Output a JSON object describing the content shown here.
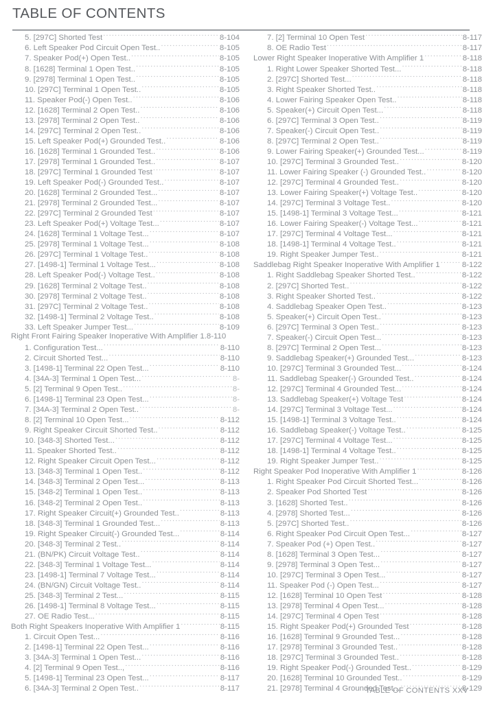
{
  "document": {
    "title": "TABLE OF CONTENTS",
    "footer": "TABLE OF CONTENTS XXV"
  },
  "columns": [
    {
      "name": "left-column",
      "entries": [
        {
          "level": "item",
          "label": "5. [297C] Shorted Test",
          "page": "8-104"
        },
        {
          "level": "item",
          "label": "6. Left Speaker Pod Circuit Open Test..",
          "page": "8-105"
        },
        {
          "level": "item",
          "label": "7. Speaker Pod(+) Open Test..",
          "page": "8-105"
        },
        {
          "level": "item",
          "label": "8. [1628] Terminal 1 Open Test..",
          "page": "8-105"
        },
        {
          "level": "item",
          "label": "9. [2978] Terminal 1 Open Test..",
          "page": "8-105"
        },
        {
          "level": "item",
          "label": "10. [297C] Terminal 1 Open Test..",
          "page": "8-105"
        },
        {
          "level": "item",
          "label": "11. Speaker Pod(-) Open Test..",
          "page": "8-106"
        },
        {
          "level": "item",
          "label": "12. [1628] Terminal 2 Open Test..",
          "page": "8-106"
        },
        {
          "level": "item",
          "label": "13. [2978] Terminal 2 Open Test..",
          "page": "8-106"
        },
        {
          "level": "item",
          "label": "14. [297C] Terminal 2 Open Test..",
          "page": "8-106"
        },
        {
          "level": "item",
          "label": "15. Left Speaker Pod(+) Grounded Test..",
          "page": "8-106"
        },
        {
          "level": "item",
          "label": "16. [1628] Terminal 1 Grounded Test..",
          "page": "8-106"
        },
        {
          "level": "item",
          "label": "17. [2978] Terminal 1 Grounded Test..",
          "page": "8-107"
        },
        {
          "level": "item",
          "label": "18. [297C] Terminal 1 Grounded Test",
          "page": "8-107"
        },
        {
          "level": "item",
          "label": "19. Left Speaker Pod(-) Grounded Test..",
          "page": "8-107"
        },
        {
          "level": "item",
          "label": "20. [1628] Terminal 2 Grounded Test...",
          "page": "8-107"
        },
        {
          "level": "item",
          "label": "21. [2978] Terminal 2 Grounded Test...",
          "page": "8-107"
        },
        {
          "level": "item",
          "label": "22. [297C] Terminal 2 Grounded Test",
          "page": "8-107"
        },
        {
          "level": "item",
          "label": "23. Left Speaker Pod(+) Voltage Test...",
          "page": "8-107"
        },
        {
          "level": "item",
          "label": "24. [1628] Terminal 1 Voltage Test...",
          "page": "8-107"
        },
        {
          "level": "item",
          "label": "25. [2978] Terminal 1 Voltage Test...",
          "page": "8-108"
        },
        {
          "level": "item",
          "label": "26. [297C] Terminal 1 Voltage Test..",
          "page": "8-108"
        },
        {
          "level": "item",
          "label": "27. [1498-1] Terminal 1 Voltage Test...",
          "page": "8-108"
        },
        {
          "level": "item",
          "label": "28. Left Speaker Pod(-) Voltage Test..",
          "page": "8-108"
        },
        {
          "level": "item",
          "label": "29. [1628] Terminal 2 Voltage Test..",
          "page": "8-108"
        },
        {
          "level": "item",
          "label": "30. [2978] Terminal 2 Voltage Test..",
          "page": "8-108"
        },
        {
          "level": "item",
          "label": "31. [297C] Terminal 2 Voltage Test..",
          "page": "8-108"
        },
        {
          "level": "item",
          "label": "32. [1498-1] Terminal 2 Voltage Test..",
          "page": "8-108"
        },
        {
          "level": "item",
          "label": "33. Left Speaker Jumper Test...",
          "page": "8-109"
        },
        {
          "level": "heading",
          "no_leader": true,
          "label": "Right Front Fairing Speaker Inoperative With Amplifier 1.",
          "page": "8-110"
        },
        {
          "level": "item",
          "label": "1. Configuration Test...",
          "page": "8-110"
        },
        {
          "level": "item",
          "label": "2. Circuit Shorted Test...",
          "page": "8-110"
        },
        {
          "level": "item",
          "label": "3. [1498-1] Terminal 22 Open Test...",
          "page": "8-110"
        },
        {
          "level": "item",
          "label": "4. [34A-3] Terminal 1 Open Test...",
          "page": "8-",
          "faded": true
        },
        {
          "level": "item",
          "label": "5. [2] Terminal 9 Open Test..",
          "page": "8-",
          "faded": true
        },
        {
          "level": "item",
          "label": "6. [1498-1] Terminal 23 Open Test...",
          "page": "8-",
          "faded": true
        },
        {
          "level": "item",
          "label": "7. [34A-3] Terminal 2 Open Test..",
          "page": "8-",
          "faded": true
        },
        {
          "level": "item",
          "label": "8. [2] Terminal 10 Open Test...",
          "page": "8-112"
        },
        {
          "level": "item",
          "label": "9. Right Speaker Circuit Shorted Test..",
          "page": "8-112"
        },
        {
          "level": "item",
          "label": "10. [348-3] Shorted Test...",
          "page": "8-112"
        },
        {
          "level": "item",
          "label": "11. Speaker Shorted Test..",
          "page": "8-112"
        },
        {
          "level": "item",
          "label": "12. Right Speaker Circuit Open Test...",
          "page": "8-112"
        },
        {
          "level": "item",
          "label": "13. [348-3] Terminal 1 Open Test..",
          "page": "8-112"
        },
        {
          "level": "item",
          "label": "14. [348-3] Terminal 2 Open Test...",
          "page": "8-113"
        },
        {
          "level": "item",
          "label": "15. [348-2] Terminal 1 Open Test..",
          "page": "8-113"
        },
        {
          "level": "item",
          "label": "16. [348-2] Terminal 2 Open Test..",
          "page": "8-113"
        },
        {
          "level": "item",
          "label": "17. Right Speaker Circuit(+) Grounded Test..",
          "page": "8-113"
        },
        {
          "level": "item",
          "label": "18. [348-3] Terminal 1 Grounded Test...",
          "page": "8-113"
        },
        {
          "level": "item",
          "label": "19. Right Speaker Circuit(-) Grounded Test...",
          "page": "8-114"
        },
        {
          "level": "item",
          "label": "20. [348-3] Terminal 2 Test..",
          "page": "8-114"
        },
        {
          "level": "item",
          "label": "21. (BN/PK) Circuit Voltage Test..",
          "page": "8-114"
        },
        {
          "level": "item",
          "label": "22. [348-3] Terminal 1 Voltage Test...",
          "page": "8-114"
        },
        {
          "level": "item",
          "label": "23. [1498-1] Terminal 7 Voltage Test...",
          "page": "8-114"
        },
        {
          "level": "item",
          "label": "24. (BN/GN) Circuit Voltage Test..",
          "page": "8-114"
        },
        {
          "level": "item",
          "label": "25. [348-3] Terminal 2 Test...",
          "page": "8-115"
        },
        {
          "level": "item",
          "label": "26. [1498-1] Terminal 8 Voltage Test...",
          "page": "8-115"
        },
        {
          "level": "item",
          "label": "27. OE Radio Test...",
          "page": "8-115"
        },
        {
          "level": "heading",
          "label": "Both Right Speakers Inoperative With Amplifier 1",
          "page": "8-115"
        },
        {
          "level": "item",
          "label": "1. Circuit Open Test...",
          "page": "8-116"
        },
        {
          "level": "item",
          "label": "2. [1498-1] Terminal 22 Open Test...",
          "page": "8-116"
        },
        {
          "level": "item",
          "label": "3. [34A-3] Terminal 1 Open Test...",
          "page": "8-116"
        },
        {
          "level": "item",
          "label": "4. [2] Terminal 9 Open Test..,",
          "page": "8-116"
        },
        {
          "level": "item",
          "label": "5. [1498-1] Terminal 23 Open Test...",
          "page": "8-117"
        },
        {
          "level": "item",
          "label": "6. [34A-3] Terminal 2 Open Test..",
          "page": "8-117"
        }
      ]
    },
    {
      "name": "right-column",
      "entries": [
        {
          "level": "item",
          "label": "7. [2] Terminal 10 Open Test",
          "page": "8-117"
        },
        {
          "level": "item",
          "label": "8. OE Radio Test",
          "page": "8-117"
        },
        {
          "level": "heading",
          "label": "Lower Right Speaker Inoperative With Amplifier 1",
          "page": "8-118"
        },
        {
          "level": "item",
          "label": "1. Right Lower Speaker Shorted Test...",
          "page": "8-118"
        },
        {
          "level": "item",
          "label": "2. [297C] Shorted Test...",
          "page": "8-118"
        },
        {
          "level": "item",
          "label": "3. Right Speaker Shorted Test..",
          "page": "8-118"
        },
        {
          "level": "item",
          "label": "4. Lower Fairing Speaker Open Test..",
          "page": "8-118"
        },
        {
          "level": "item",
          "label": "5. Speaker(+) Circuit Open Test...",
          "page": "8-118"
        },
        {
          "level": "item",
          "label": "6. [297C] Terminal 3 Open Test..",
          "page": "8-119"
        },
        {
          "level": "item",
          "label": "7. Speaker(-) Circuit Open Test..",
          "page": "8-119"
        },
        {
          "level": "item",
          "label": "8. [297C] Terminal 2 Open Test..",
          "page": "8-119"
        },
        {
          "level": "item",
          "label": "9. Lower Fairing Speaker(+) Grounded Test...",
          "page": "8-119"
        },
        {
          "level": "item",
          "label": "10. [297C] Terminal 3 Grounded Test..",
          "page": "8-120"
        },
        {
          "level": "item",
          "label": "11. Lower Fairing Speaker (-) Grounded Test..",
          "page": "8-120"
        },
        {
          "level": "item",
          "label": "12. [297C] Terminal 4 Grounded Test..",
          "page": "8-120"
        },
        {
          "level": "item",
          "label": "13. Lower Fairing Speaker(+) Voltage Test..",
          "page": "8-120"
        },
        {
          "level": "item",
          "label": "14. [297C] Terminal 3 Voltage Test..",
          "page": "8-120"
        },
        {
          "level": "item",
          "label": "15. [1498-1] Terminal 3 Voltage Test...",
          "page": "8-121"
        },
        {
          "level": "item",
          "label": "16. Lower Fairing Speaker(-) Voltage Test...",
          "page": "8-121"
        },
        {
          "level": "item",
          "label": "17. [297C] Terminal 4 Voltage Test...",
          "page": "8-121"
        },
        {
          "level": "item",
          "label": "18. [1498-1] Terminal 4 Voltage Test..",
          "page": "8-121"
        },
        {
          "level": "item",
          "label": "19. Right Speaker Jumper Test..",
          "page": "8-121"
        },
        {
          "level": "heading",
          "label": "Saddlebag Right Speaker Inoperative With Amplifier 1",
          "page": "8-122"
        },
        {
          "level": "item",
          "label": "1. Right Saddlebag Speaker Shorted Test..",
          "page": "8-122"
        },
        {
          "level": "item",
          "label": "2. [297C] Shorted Test..",
          "page": "8-122"
        },
        {
          "level": "item",
          "label": "3. Right Speaker Shorted Test..",
          "page": "8-122"
        },
        {
          "level": "item",
          "label": "4. Saddlebag Speaker Open Test..",
          "page": "8-123"
        },
        {
          "level": "item",
          "label": "5. Speaker(+) Circuit Open Test..",
          "page": "8-123"
        },
        {
          "level": "item",
          "label": "6. [297C] Terminal 3 Open Test..",
          "page": "8-123"
        },
        {
          "level": "item",
          "label": "7. Speaker(-) Circuit Open Test...",
          "page": "8-123"
        },
        {
          "level": "item",
          "label": "8. [297C] Terminal 2 Open Test...",
          "page": "8-123"
        },
        {
          "level": "item",
          "label": "9. Saddlebag Speaker(+) Grounded Test...",
          "page": "8-123"
        },
        {
          "level": "item",
          "label": "10. [297C] Terminal 3 Grounded Test...",
          "page": "8-124"
        },
        {
          "level": "item",
          "label": "11. Saddlebag Speaker(-) Grounded Test..",
          "page": "8-124"
        },
        {
          "level": "item",
          "label": "12. [297C] Terminal 4 Grounded Test...",
          "page": "8-124"
        },
        {
          "level": "item",
          "label": "13. Saddlebag Speaker(+) Voltage Test",
          "page": "8-124"
        },
        {
          "level": "item",
          "label": "14. [297C] Terminal 3 Voltage Test...",
          "page": "8-124"
        },
        {
          "level": "item",
          "label": "15. [1498-1] Terminal 3 Voltage Test..",
          "page": "8-124"
        },
        {
          "level": "item",
          "label": "16. Saddlebag Speaker(-) Voltage Test..",
          "page": "8-125"
        },
        {
          "level": "item",
          "label": "17. [297C] Terminal 4 Voltage Test...",
          "page": "8-125"
        },
        {
          "level": "item",
          "label": "18. [1498-1] Terminal 4 Voltage Test..",
          "page": "8-125"
        },
        {
          "level": "item",
          "label": "19. Right Speaker Jumper Test..",
          "page": "8-125"
        },
        {
          "level": "heading",
          "label": "Right Speaker Pod Inoperative With Amplifier 1",
          "page": "8-126"
        },
        {
          "level": "item",
          "label": "1. Right Speaker Pod Circuit Shorted Test...",
          "page": "8-126"
        },
        {
          "level": "item",
          "label": "2. Speaker Pod Shorted Test",
          "page": "8-126"
        },
        {
          "level": "item",
          "label": "3. [1628] Shorted Test..",
          "page": "8-126"
        },
        {
          "level": "item",
          "label": "4. [2978] Shorted Test...",
          "page": "8-126"
        },
        {
          "level": "item",
          "label": "5. [297C] Shorted Test..",
          "page": "8-126"
        },
        {
          "level": "item",
          "label": "6. Right Speaker Pod Circuit Open Test...",
          "page": "8-127"
        },
        {
          "level": "item",
          "label": "7. Speaker Pod (+) Open Test..",
          "page": "8-127"
        },
        {
          "level": "item",
          "label": "8. [1628] Terminal 3 Open Test...",
          "page": "8-127"
        },
        {
          "level": "item",
          "label": "9. [2978] Terminal 3 Open Test...",
          "page": "8-127"
        },
        {
          "level": "item",
          "label": "10. [297C] Terminal 3 Open Test...",
          "page": "8-127"
        },
        {
          "level": "item",
          "label": "11. Speaker Pod (-) Open Test...",
          "page": "8-127"
        },
        {
          "level": "item",
          "label": "12. [1628] Terminal 10 Open Test",
          "page": "8-128"
        },
        {
          "level": "item",
          "label": "13. [2978] Terminal 4 Open Test...",
          "page": "8-128"
        },
        {
          "level": "item",
          "label": "14. [297C] Terminal 4 Open Test",
          "page": "8-128"
        },
        {
          "level": "item",
          "label": "15. Right Speaker Pod(+) Grounded Test",
          "page": "8-128"
        },
        {
          "level": "item",
          "label": "16. [1628] Terminal 9 Grounded Test...",
          "page": "8-128"
        },
        {
          "level": "item",
          "label": "17. [2978] Terminal 3 Grounded Test..",
          "page": "8-128"
        },
        {
          "level": "item",
          "label": "18. [297C] Terminal 3 Grounded Test..",
          "page": "8-128"
        },
        {
          "level": "item",
          "label": "19. Right Speaker Pod(-) Grounded Test..",
          "page": "8-129"
        },
        {
          "level": "item",
          "label": "20. [1628] Terminal 10 Grounded Test..",
          "page": "8-129"
        },
        {
          "level": "item",
          "label": "21. [2978] Terminal 4 Grounded Test...",
          "page": "8-129"
        }
      ]
    }
  ]
}
